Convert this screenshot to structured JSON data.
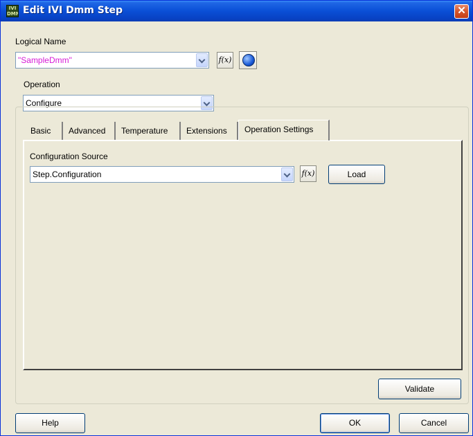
{
  "window": {
    "title": "Edit IVI Dmm Step",
    "icon": "ivi-dmm-icon",
    "close_glyph": "✕"
  },
  "logical_name": {
    "label": "Logical Name",
    "value": "\"SampleDmm\"",
    "value_color": "#d61ad6"
  },
  "fx_label": "f(x)",
  "operation": {
    "label": "Operation",
    "value": "Configure"
  },
  "tabs": [
    {
      "label": "Basic",
      "active": false
    },
    {
      "label": "Advanced",
      "active": false
    },
    {
      "label": "Temperature",
      "active": false
    },
    {
      "label": "Extensions",
      "active": false
    },
    {
      "label": "Operation Settings",
      "active": true
    }
  ],
  "operation_settings": {
    "config_source_label": "Configuration Source",
    "config_source_value": "Step.Configuration",
    "load_label": "Load"
  },
  "buttons": {
    "validate": "Validate",
    "help": "Help",
    "ok": "OK",
    "cancel": "Cancel"
  }
}
